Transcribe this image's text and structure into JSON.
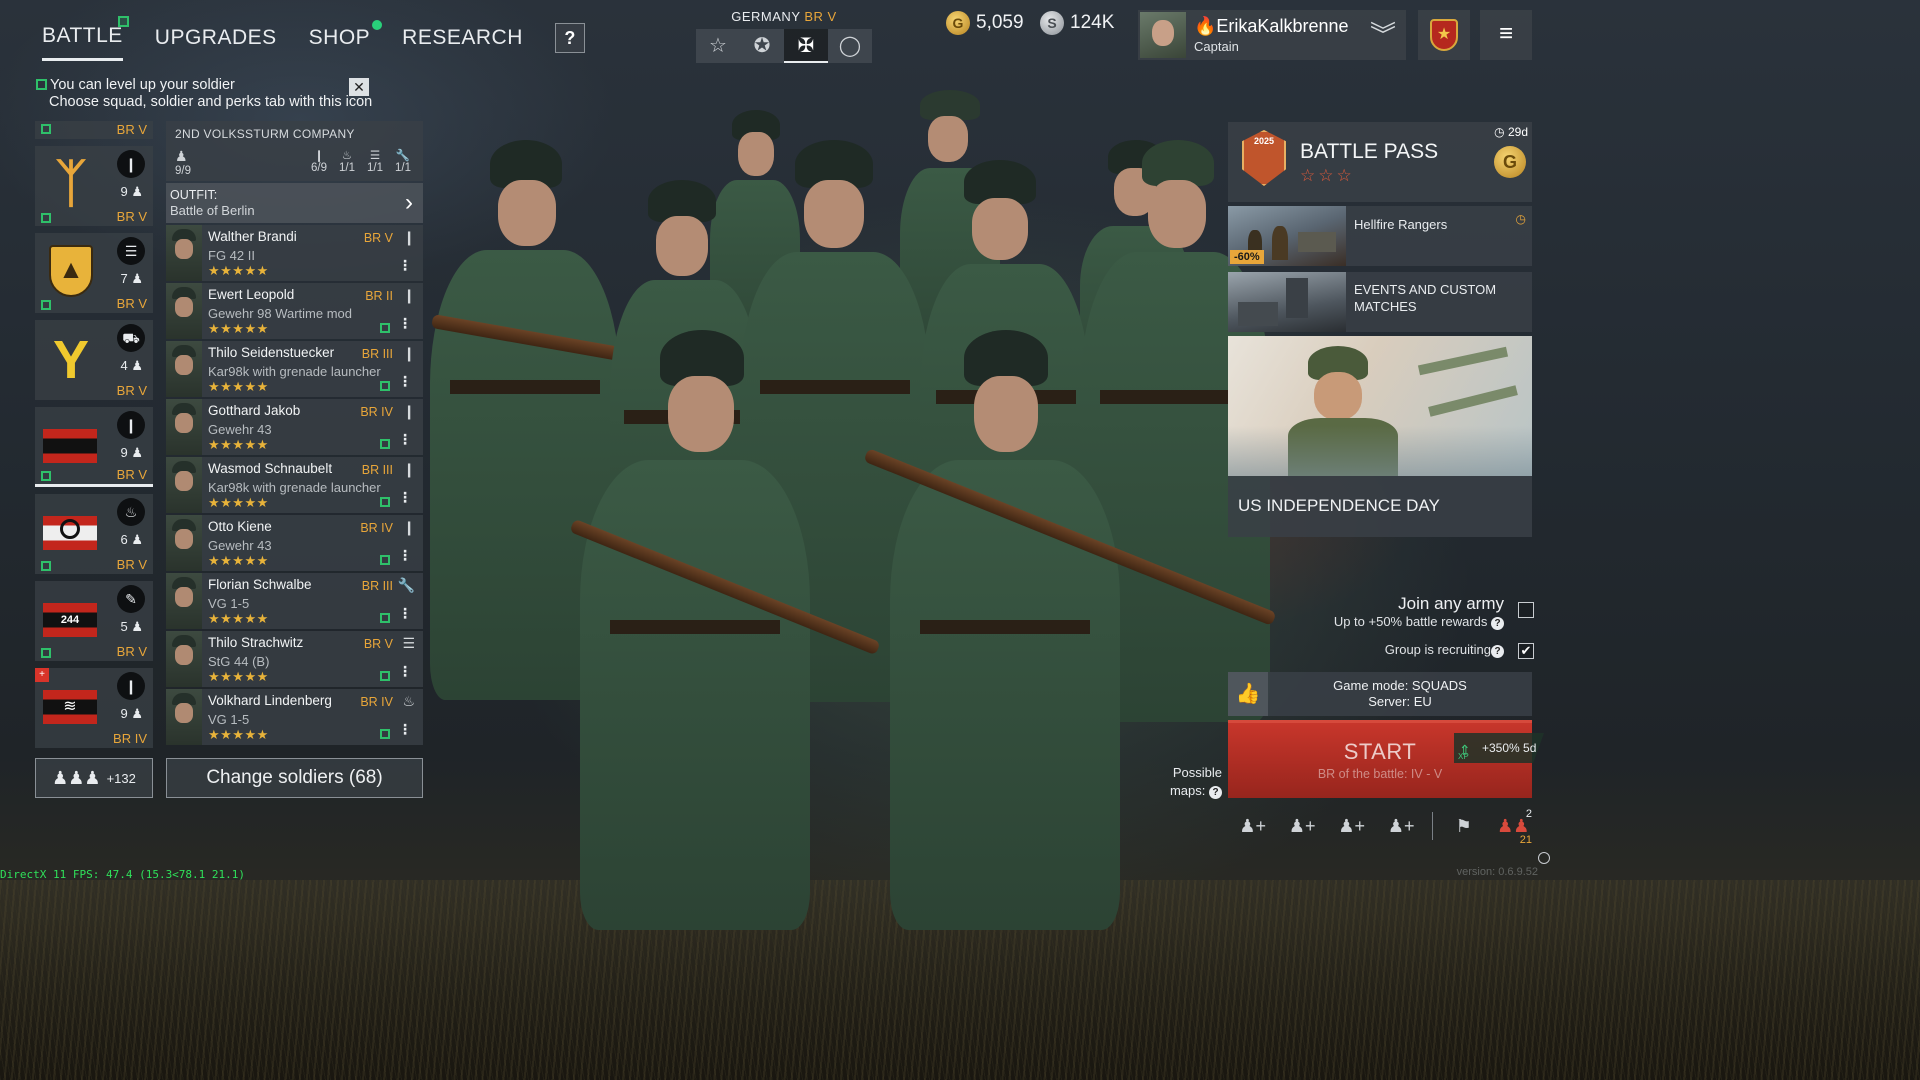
{
  "nav": {
    "tabs": [
      {
        "label": "BATTLE"
      },
      {
        "label": "UPGRADES"
      },
      {
        "label": "SHOP"
      },
      {
        "label": "RESEARCH"
      }
    ],
    "help_label": "?"
  },
  "hint": {
    "line1": "You can level up your soldier",
    "line2": "Choose squad, soldier and perks tab with this icon",
    "close_label": "✕"
  },
  "nation": {
    "label": "GERMANY",
    "br": "BR V"
  },
  "currency": {
    "gold": "5,059",
    "silver": "124K",
    "gold_symbol": "G",
    "silver_symbol": "S"
  },
  "profile": {
    "name": "🔥ErikaKalkbrenne",
    "rank": "Captain"
  },
  "squads": {
    "top_br": "BR V",
    "cards": [
      {
        "count": "9",
        "br": "BR V",
        "class_icon": "rifle-icon"
      },
      {
        "count": "7",
        "br": "BR V",
        "class_icon": "list-icon"
      },
      {
        "count": "4",
        "br": "BR V",
        "class_icon": "vehicle-icon"
      },
      {
        "count": "9",
        "br": "BR V",
        "class_icon": "rifle-icon"
      },
      {
        "count": "6",
        "br": "BR V",
        "class_icon": "flame-icon"
      },
      {
        "count": "5",
        "br": "BR V",
        "class_icon": "mortar-icon",
        "emblem_text": "244"
      },
      {
        "count": "9",
        "br": "BR IV",
        "class_icon": "rifle-icon"
      }
    ],
    "reserve_label": "+132"
  },
  "company": {
    "name": "2ND VOLKSSTURM COMPANY",
    "stats": [
      "9/9",
      "6/9",
      "1/1",
      "1/1",
      "1/1"
    ],
    "outfit_label": "OUTFIT:",
    "outfit_value": "Battle of Berlin"
  },
  "soldiers": [
    {
      "name": "Walther Brandi",
      "weapon": "FG 42 II",
      "br": "BR V",
      "stars": "★★★★★",
      "class": "rifle"
    },
    {
      "name": "Ewert Leopold",
      "weapon": "Gewehr 98 Wartime mod",
      "br": "BR II",
      "stars": "★★★★★",
      "class": "rifle"
    },
    {
      "name": "Thilo Seidenstuecker",
      "weapon": "Kar98k with grenade launcher",
      "br": "BR III",
      "stars": "★★★★★",
      "class": "rifle"
    },
    {
      "name": "Gotthard Jakob",
      "weapon": "Gewehr 43",
      "br": "BR IV",
      "stars": "★★★★★",
      "class": "rifle"
    },
    {
      "name": "Wasmod Schnaubelt",
      "weapon": "Kar98k with grenade launcher",
      "br": "BR III",
      "stars": "★★★★★",
      "class": "rifle"
    },
    {
      "name": "Otto Kiene",
      "weapon": "Gewehr 43",
      "br": "BR IV",
      "stars": "★★★★★",
      "class": "rifle"
    },
    {
      "name": "Florian Schwalbe",
      "weapon": "VG 1-5",
      "br": "BR III",
      "stars": "★★★★★",
      "class": "engineer"
    },
    {
      "name": "Thilo Strachwitz",
      "weapon": "StG 44 (B)",
      "br": "BR V",
      "stars": "★★★★★",
      "class": "radio"
    },
    {
      "name": "Volkhard Lindenberg",
      "weapon": "VG 1-5",
      "br": "BR IV",
      "stars": "★★★★★",
      "class": "flame"
    }
  ],
  "change_soldiers_label": "Change soldiers (68)",
  "battle_pass": {
    "title": "BATTLE PASS",
    "stars": "☆☆☆",
    "timer": "29d",
    "year": "2025",
    "coin_symbol": "G"
  },
  "events": [
    {
      "label": "Hellfire Rangers",
      "discount": "-60%"
    },
    {
      "label": "EVENTS AND CUSTOM MATCHES"
    }
  ],
  "independence": {
    "label": "US INDEPENDENCE DAY"
  },
  "join": {
    "title": "Join any army",
    "subtitle": "Up to +50% battle rewards",
    "recruiting": "Group is recruiting",
    "recruiting_check": "✔"
  },
  "game_mode": {
    "mode": "Game mode: SQUADS",
    "server": "Server: EU"
  },
  "start": {
    "label": "START",
    "sub": "BR of the battle: IV - V",
    "xp": "+350% 5d",
    "xp_unit": "XP"
  },
  "maps": {
    "label1": "Possible",
    "label2": "maps:"
  },
  "party": {
    "top": "2",
    "bottom": "21"
  },
  "debug": {
    "fps": "DirectX 11 FPS: 47.4 (15.3<78.1 21.1)",
    "version": "version: 0.6.9.52"
  }
}
